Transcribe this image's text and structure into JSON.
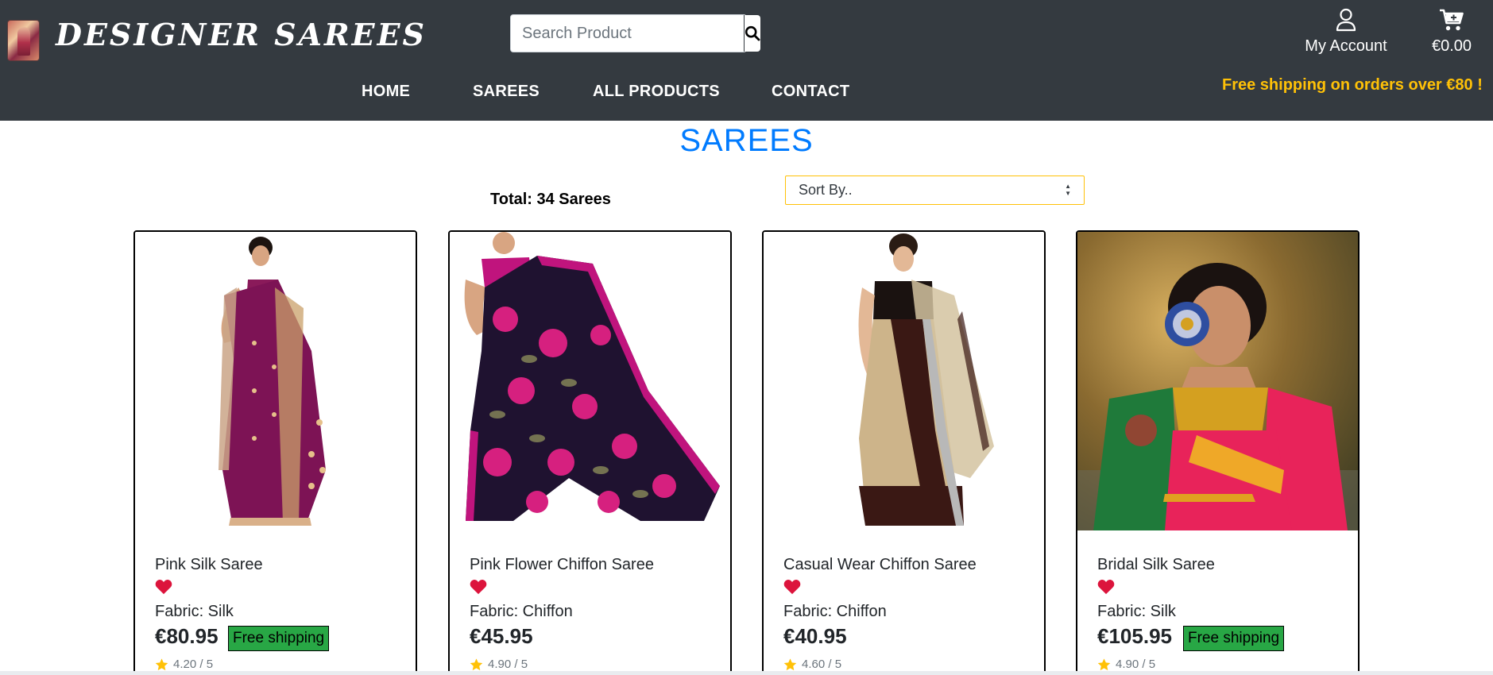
{
  "header": {
    "brand": "DESIGNER SAREES",
    "search": {
      "placeholder": "Search Product"
    },
    "account_label": "My Account",
    "cart_total": "€0.00",
    "nav": [
      {
        "label": "HOME"
      },
      {
        "label": "SAREES"
      },
      {
        "label": "ALL PRODUCTS"
      },
      {
        "label": "CONTACT"
      }
    ],
    "shipping_banner": "Free shipping on orders over €80 !"
  },
  "page": {
    "title": "SAREES",
    "total": "Total: 34 Sarees",
    "sort_label": "Sort By.."
  },
  "colors": {
    "header_bg": "#343a40",
    "title_blue": "#007bff",
    "banner_yellow": "#ffc107",
    "free_shipping_green": "#28a745",
    "heart_red": "#dc143c"
  },
  "products": [
    {
      "name": "Pink Silk Saree",
      "fabric": "Fabric: Silk",
      "price": "€80.95",
      "free_shipping": "Free shipping",
      "rating": "4.20 / 5",
      "image": "saree-purple-silk"
    },
    {
      "name": "Pink Flower Chiffon Saree",
      "fabric": "Fabric: Chiffon",
      "price": "€45.95",
      "free_shipping": "",
      "rating": "4.90 / 5",
      "image": "saree-floral-chiffon"
    },
    {
      "name": "Casual Wear Chiffon Saree",
      "fabric": "Fabric: Chiffon",
      "price": "€40.95",
      "free_shipping": "",
      "rating": "4.60 / 5",
      "image": "saree-beige-net"
    },
    {
      "name": "Bridal Silk Saree",
      "fabric": "Fabric: Silk",
      "price": "€105.95",
      "free_shipping": "Free shipping",
      "rating": "4.90 / 5",
      "image": "saree-bridal-photo"
    }
  ]
}
